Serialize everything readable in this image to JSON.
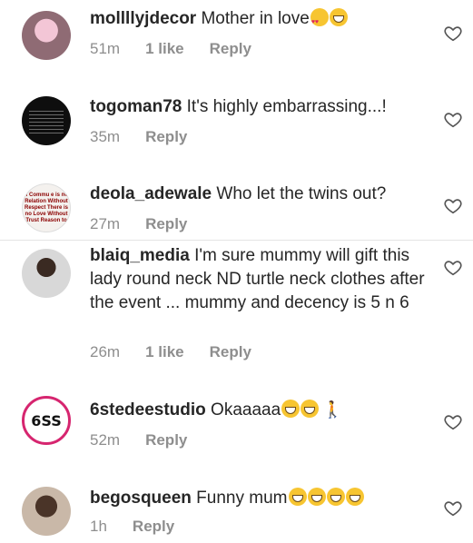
{
  "comments": [
    {
      "username": "mollllyjdecor",
      "text": " Mother in love",
      "emojis": [
        "heart-eyes",
        "laugh"
      ],
      "time": "51m",
      "likes": "1 like",
      "reply": "Reply"
    },
    {
      "username": "togoman78",
      "text": " It's highly embarrassing...!",
      "emojis": [],
      "time": "35m",
      "likes": "",
      "reply": "Reply"
    },
    {
      "username": "deola_adewale",
      "text": " Who let the twins out?",
      "emojis": [],
      "time": "27m",
      "likes": "",
      "reply": "Reply",
      "avatar_text": "ll Commu e is no Relation Without Respect There is no Love Without Trust Reason to"
    },
    {
      "username": "blaiq_media",
      "text": " I'm sure mummy will gift this lady round neck ND turtle neck clothes after the event ... mummy and decency is 5 n 6",
      "emojis": [],
      "time": "26m",
      "likes": "1 like",
      "reply": "Reply"
    },
    {
      "username": "6stedeestudio",
      "text": " Okaaaaa",
      "emojis": [
        "laugh",
        "laugh",
        "walking"
      ],
      "time": "52m",
      "likes": "",
      "reply": "Reply",
      "avatar_text": "6SS"
    },
    {
      "username": "begosqueen",
      "text": " Funny mum",
      "emojis": [
        "grin",
        "grin",
        "grin",
        "grin"
      ],
      "time": "1h",
      "likes": "",
      "reply": "Reply"
    }
  ],
  "colors": {
    "text": "#262626",
    "meta": "#8e8e8e",
    "accent": "#d6256f"
  },
  "icons": {
    "like": "heart-outline-icon"
  }
}
